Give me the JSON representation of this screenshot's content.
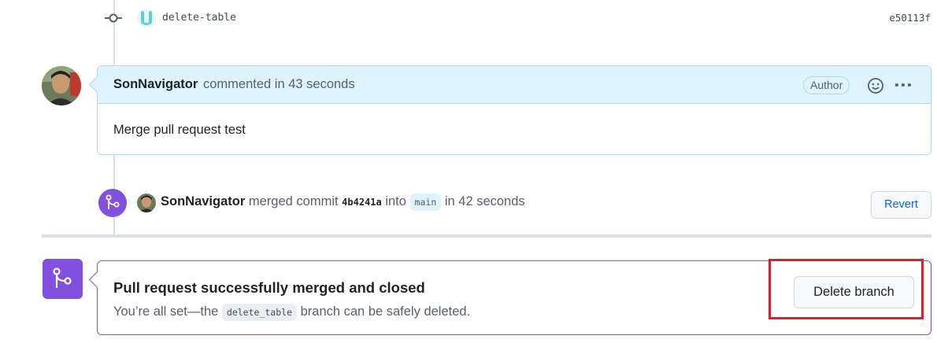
{
  "commit": {
    "avatar_icon": "bot-avatar-icon",
    "message": "delete-table",
    "sha": "e50113f"
  },
  "comment": {
    "author": "SonNavigator",
    "meta": "commented in 43 seconds",
    "badge": "Author",
    "body": "Merge pull request test",
    "emoji_icon": "smiley-icon",
    "more_icon": "kebab-horizontal-icon"
  },
  "merge_event": {
    "actor": "SonNavigator",
    "verb": "merged commit",
    "sha": "4b4241a",
    "into": "into",
    "target_branch": "main",
    "time": "in 42 seconds",
    "revert_label": "Revert"
  },
  "status": {
    "title": "Pull request successfully merged and closed",
    "desc_prefix": "You’re all set—the",
    "branch": "delete_table",
    "desc_suffix": "branch can be safely deleted.",
    "delete_label": "Delete branch"
  },
  "colors": {
    "merged_purple": "#8250df",
    "link_blue": "#0969da",
    "highlight_red": "#d1242f"
  }
}
